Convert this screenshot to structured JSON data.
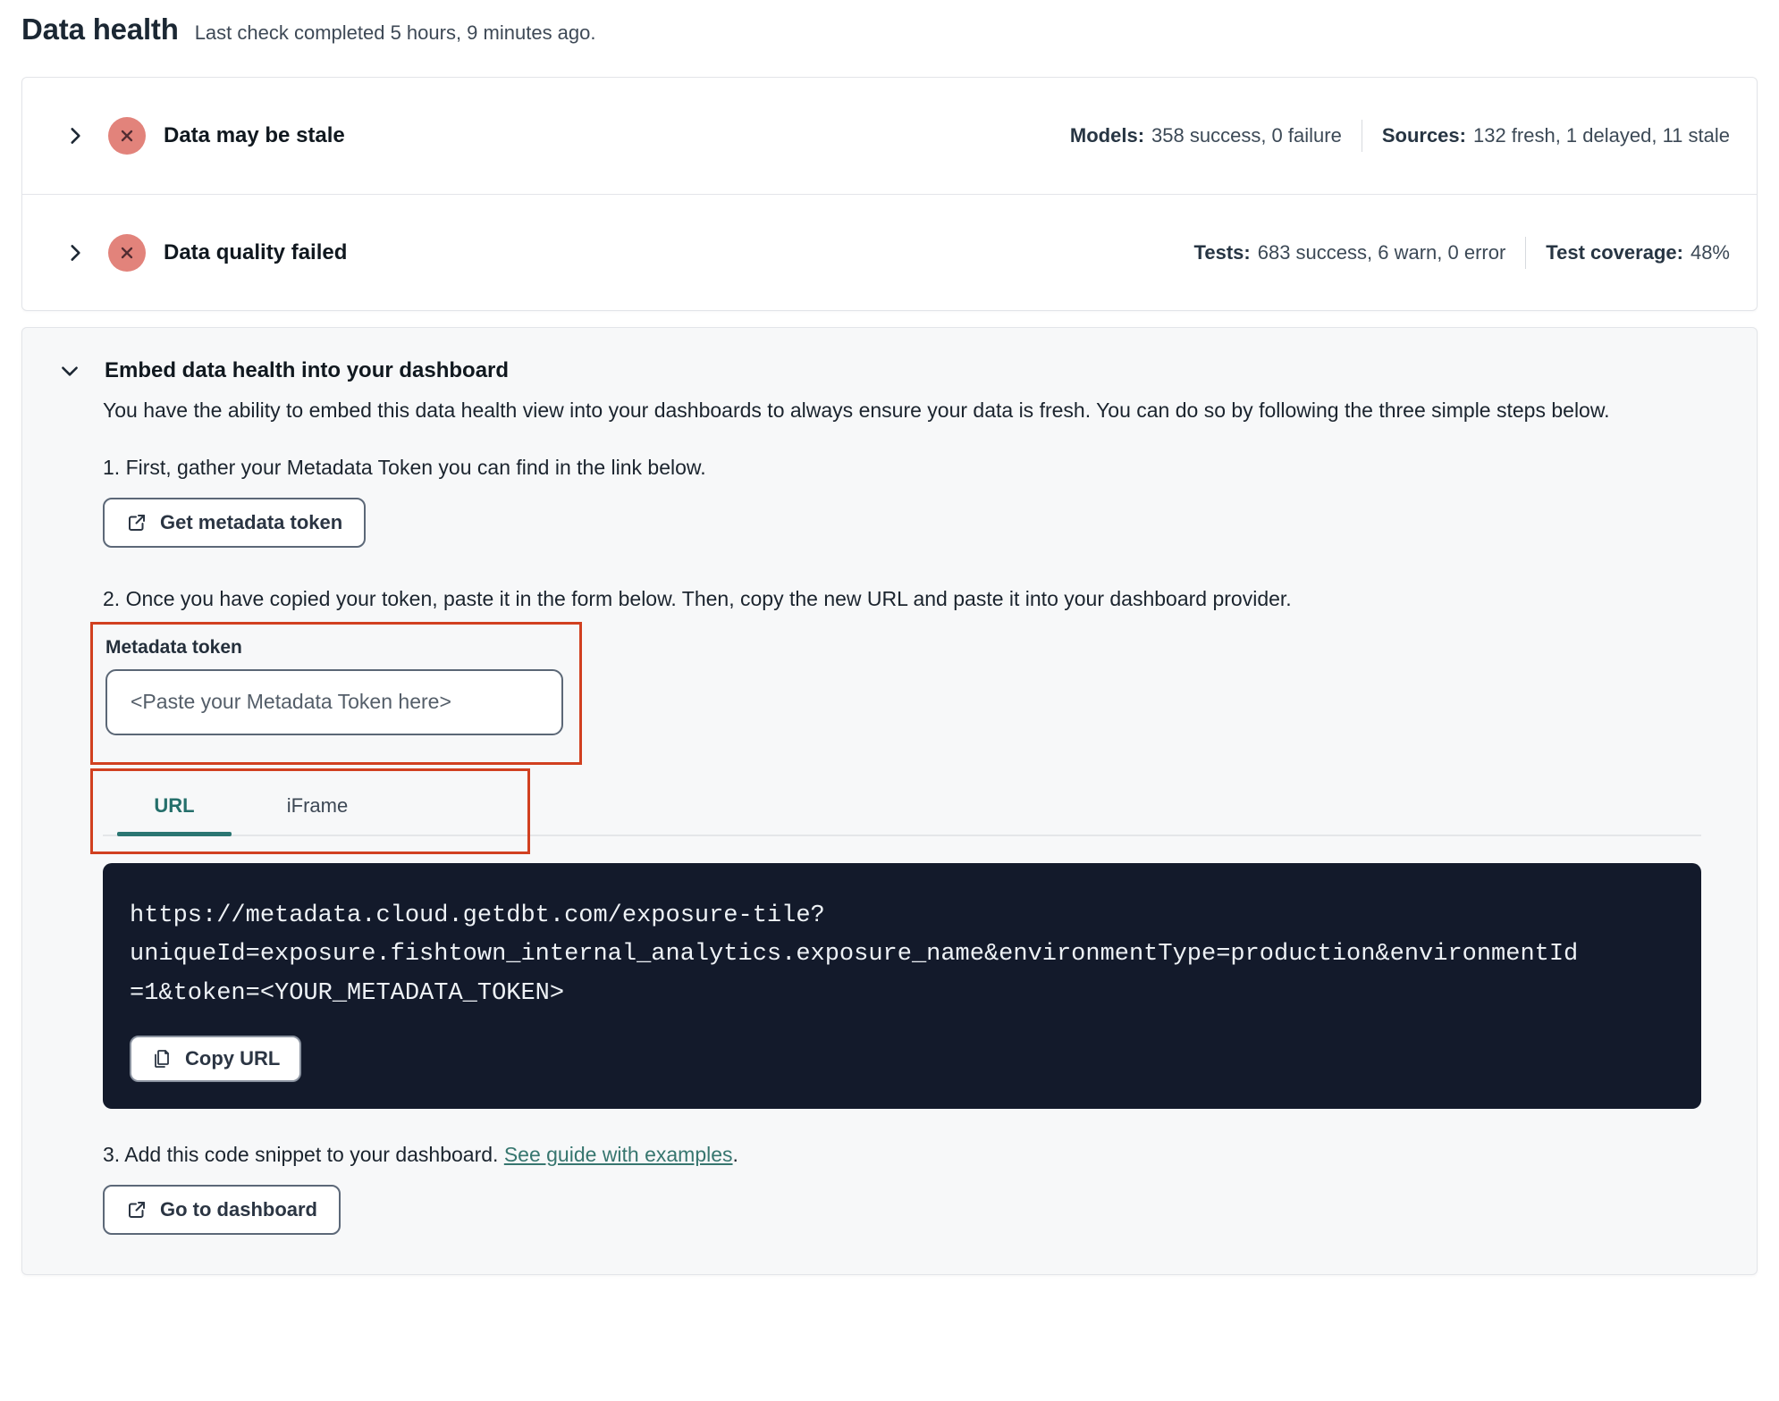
{
  "page": {
    "title": "Data health",
    "subtitle": "Last check completed 5 hours, 9 minutes ago."
  },
  "status_cards": [
    {
      "title": "Data may be stale",
      "icon": "x-circle-icon",
      "stats": [
        {
          "label": "Models:",
          "value": "358 success, 0 failure"
        },
        {
          "label": "Sources:",
          "value": "132 fresh, 1 delayed, 11 stale"
        }
      ]
    },
    {
      "title": "Data quality failed",
      "icon": "x-circle-icon",
      "stats": [
        {
          "label": "Tests:",
          "value": "683 success, 6 warn, 0 error"
        },
        {
          "label": "Test coverage:",
          "value": "48%"
        }
      ]
    }
  ],
  "embed": {
    "title": "Embed data health into your dashboard",
    "description": "You have the ability to embed this data health view into your dashboards to always ensure your data is fresh. You can do so by following the three simple steps below.",
    "step1": "1. First, gather your Metadata Token you can find in the link below.",
    "get_token_button": "Get metadata token",
    "step2": "2. Once you have copied your token, paste it in the form below. Then, copy the new URL and paste it into your dashboard provider.",
    "token_field": {
      "label": "Metadata token",
      "value": "",
      "placeholder": "<Paste your Metadata Token here>"
    },
    "tabs": [
      {
        "label": "URL",
        "active": true
      },
      {
        "label": "iFrame",
        "active": false
      }
    ],
    "code": {
      "lines": {
        "0": "https://metadata.cloud.getdbt.com/exposure-tile?",
        "1": "uniqueId=exposure.fishtown_internal_analytics.exposure_name&environmentType=production&environmentId",
        "2": "=1&token=<YOUR_METADATA_TOKEN>"
      },
      "copy_button": "Copy URL"
    },
    "step3_prefix": "3. Add this code snippet to your dashboard. ",
    "step3_link": "See guide with examples",
    "step3_suffix": ".",
    "dashboard_button": "Go to dashboard"
  },
  "colors": {
    "annotation_red": "#d14020",
    "accent_teal": "#2b7672",
    "status_icon_bg": "#e2837b",
    "status_icon_glyph": "#522c32",
    "code_background": "#131a2b"
  }
}
